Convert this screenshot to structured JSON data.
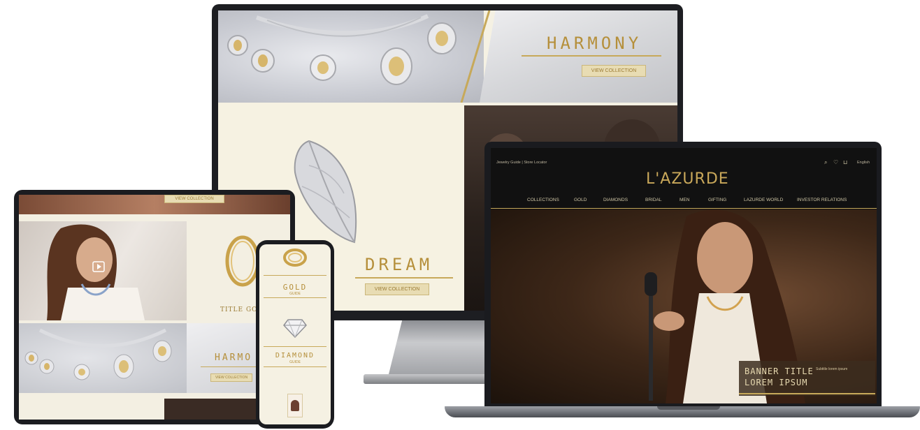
{
  "monitor": {
    "harmony_title": "HARMONY",
    "harmony_button": "VIEW COLLECTION",
    "dream_title": "DREAM",
    "dream_button": "VIEW COLLECTION"
  },
  "laptop": {
    "top_links": "Jewelry Guide  |  Store Locator",
    "language": "English",
    "brand": "L'AZURDE",
    "nav": [
      "COLLECTIONS",
      "GOLD",
      "DIAMONDS",
      "BRIDAL",
      "MEN",
      "GIFTING",
      "LAZURDE WORLD",
      "INVESTOR RELATIONS"
    ],
    "banner_title_line1": "BANNER TITLE",
    "banner_title_line2": "LOREM IPSUM",
    "banner_subtitle": "Subtitle lorem ipsum"
  },
  "tablet": {
    "top_button": "VIEW COLLECTION",
    "title_goes": "TITLE GOES",
    "harmony_title": "HARMO",
    "harmony_button": "VIEW COLLECTION"
  },
  "phone": {
    "gold_title": "GOLD",
    "gold_sub": "GUIDE",
    "diamond_title": "DIAMOND",
    "diamond_sub": "GUIDE"
  },
  "colors": {
    "gold": "#b58f3a",
    "cream": "#f5f1e3",
    "bezel": "#1b1c20"
  }
}
